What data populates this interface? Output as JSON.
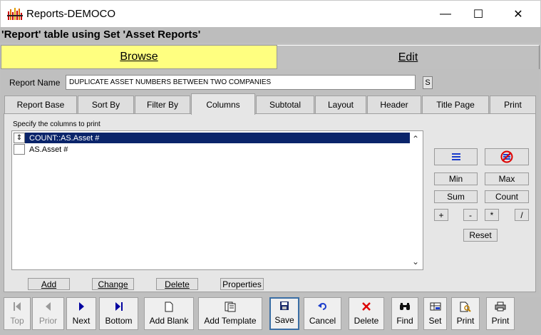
{
  "window": {
    "title": "Reports-DEMOCO",
    "minimize_glyph": "—",
    "maximize_glyph": "☐",
    "close_glyph": "✕"
  },
  "header": {
    "subtitle": "'Report' table using Set 'Asset Reports'"
  },
  "mode_tabs": {
    "browse": "Browse",
    "edit": "Edit"
  },
  "report_name": {
    "label": "Report Name",
    "value": "DUPLICATE ASSET NUMBERS BETWEEN TWO COMPANIES",
    "side_button": "S"
  },
  "tabs": [
    "Report Base",
    "Sort By",
    "Filter By",
    "Columns",
    "Subtotal",
    "Layout",
    "Header",
    "Title Page",
    "Print"
  ],
  "active_tab": "Columns",
  "columns_panel": {
    "instruction": "Specify the columns to print",
    "rows": [
      {
        "handle": "⇕",
        "text": "COUNT::AS.Asset #",
        "selected": true
      },
      {
        "handle": "",
        "text": "AS.Asset #",
        "selected": false
      }
    ]
  },
  "list_buttons": {
    "add": "Add",
    "change": "Change",
    "delete": "Delete",
    "properties": "Properties"
  },
  "side_buttons": {
    "min": "Min",
    "max": "Max",
    "sum": "Sum",
    "count": "Count",
    "plus": "+",
    "minus": "-",
    "times": "*",
    "divide": "/",
    "reset": "Reset"
  },
  "toolbar": {
    "top": "Top",
    "prior": "Prior",
    "next": "Next",
    "bottom": "Bottom",
    "add_blank": "Add Blank",
    "add_template": "Add Template",
    "save": "Save",
    "cancel": "Cancel",
    "delete": "Delete",
    "find": "Find",
    "set": "Set",
    "print1": "Print",
    "print2": "Print"
  },
  "colors": {
    "browse_tab": "#ffff80",
    "selection": "#0a246a",
    "panel": "#c0c0c0"
  }
}
